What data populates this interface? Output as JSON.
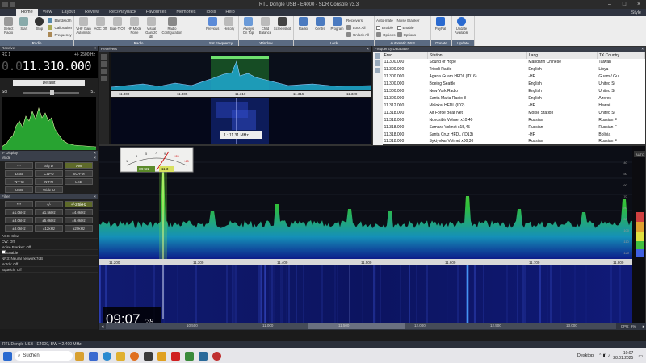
{
  "window": {
    "title": "RTL Dongle USB - E4000 - SDR Console v3.3"
  },
  "menu": {
    "items": [
      "Home",
      "View",
      "Layout",
      "Review",
      "Rec/Playback",
      "Favourites",
      "Memories",
      "Tools",
      "Help"
    ],
    "style": "Style"
  },
  "ribbon": {
    "groups": [
      {
        "label": "Radio",
        "buttons": [
          "Select Radio",
          "Start",
          "Stop"
        ],
        "small": [
          "Bandwidth",
          "Calibration",
          "Frequency"
        ]
      },
      {
        "label": "Radio",
        "buttons": [
          "VHF Gain Automatic",
          "AGC Off",
          "Bias-T Off",
          "HF Mode None",
          "Visual Gain 20 dB",
          "Radio Configuration"
        ]
      },
      {
        "label": "Set Frequency",
        "buttons": [
          "Previous",
          "History"
        ]
      },
      {
        "label": "Window",
        "buttons": [
          "Always On Top",
          "Child Balance",
          "Screenshot"
        ]
      },
      {
        "label": "Lock",
        "buttons": [
          "Radio",
          "Centre",
          "Program"
        ],
        "small": [
          "Receivers",
          "Lock All",
          "Unlock All"
        ]
      },
      {
        "label": "Automatic DSP",
        "small": [
          "Auto-mate",
          "Enable",
          "Options"
        ],
        "small2": [
          "Noise Blanker",
          "Enable",
          "Options"
        ]
      },
      {
        "label": "Donate",
        "buttons": [
          "PayPal"
        ]
      },
      {
        "label": "Update",
        "buttons": [
          "Update Available"
        ]
      }
    ]
  },
  "left": {
    "panel_title": "Receive",
    "rx": "RX 1",
    "bw": "+/- 2500 Hz",
    "freq_dim": "0.0",
    "freq_main": "11.310.000",
    "preset": "Default",
    "slider_label": "Sql",
    "slider_val": "51",
    "display_title": "IF Display",
    "mode_title": "Mode",
    "modes": [
      "***",
      "Sig D",
      "AM",
      "DSB",
      "CW-U",
      "SC-FM",
      "W-FM",
      "N-FM",
      "LSB",
      "USB",
      "Wide-U"
    ],
    "filter_title": "Filter",
    "filters": [
      "***",
      "+/-",
      "+/-2.5kHz",
      "±1.0kHz",
      "±1.5kHz",
      "±4.0kHz",
      "±3.0kHz",
      "±5.0kHz",
      "±6.0kHz",
      "±8.0kHz",
      "±12kHz",
      "±20kHz"
    ],
    "rows": [
      "AGC: Slow",
      "CW: Off",
      "Noise Blanker: Off",
      "Enable",
      "NR3: Neural network 7dB",
      "Notch: Off",
      "Squelch: Off"
    ]
  },
  "spectrum_top": {
    "title": "Receivers",
    "ticks": [
      "11.300",
      "11.305",
      "11.310",
      "11.315",
      "11.320"
    ],
    "readout": "1 : 11.31 MHz"
  },
  "freqdb": {
    "title": "Frequency Database",
    "headers": [
      "Freq",
      "Station",
      "Lang",
      "TX Country"
    ],
    "rows": [
      [
        "11.300.000",
        "Sound of Hope",
        "Mandarin Chinese",
        "Taiwan"
      ],
      [
        "11.300.000",
        "Tripoli Radio",
        "English",
        "Libya"
      ],
      [
        "11.300.000",
        "Agana Guam HFDL (ID16)",
        "-HF",
        "Guam / Gu"
      ],
      [
        "11.300.000",
        "Boeing Seattle",
        "English",
        "United St"
      ],
      [
        "11.300.000",
        "New York Radio",
        "English",
        "United St"
      ],
      [
        "11.300.000",
        "Santa Maria Radio 8",
        "English",
        "Azores"
      ],
      [
        "11.312.000",
        "Molokai HFDL (ID2)",
        "-HF",
        "Hawaii"
      ],
      [
        "11.318.000",
        "Air Force Bear Net",
        "Morse Station",
        "United St"
      ],
      [
        "11.318.000",
        "Novosibir Volmet x10,40",
        "Russian",
        "Russian F"
      ],
      [
        "11.318.000",
        "Samara Volmet x15,45",
        "Russian",
        "Russian F"
      ],
      [
        "11.318.000",
        "Santa Cruz HFDL (ID13)",
        "-HF",
        "Bolivia"
      ],
      [
        "11.318.000",
        "Syktyvkar Volmet x00,30",
        "Russian",
        "Russian F"
      ]
    ]
  },
  "main": {
    "meter_scale": [
      "1",
      "3",
      "5",
      "7",
      "9",
      "+20",
      "+40"
    ],
    "meter_tags": [
      "S9+22",
      "11.3"
    ],
    "db_ticks": [
      "-40",
      "-50",
      "-60",
      "-70",
      "-80",
      "-90",
      "-100",
      "-110",
      "-120"
    ],
    "spec_ticks": [
      "11.200",
      "11.300",
      "11.400",
      "11.500",
      "11.600",
      "11.700",
      "11.800"
    ],
    "clock": "09:07",
    "clock_sec": ":39",
    "wf_ticks": [
      "10.500",
      "11.000",
      "11.500",
      "12.000",
      "12.500",
      "13.000"
    ],
    "auto_label": "AUTO",
    "cpu": "CPU: 9%"
  },
  "status": {
    "text": "RTL Dongle USB - E4000, BW = 2.400 MHz"
  },
  "taskbar": {
    "search": "Suchen",
    "desktop": "Desktop",
    "time": "10:07",
    "date": "28.01.2025"
  },
  "colors": {
    "accent": "#2a6ad0",
    "spectrum": "#2fbf3a",
    "waterfall": "#1a2bb0"
  }
}
